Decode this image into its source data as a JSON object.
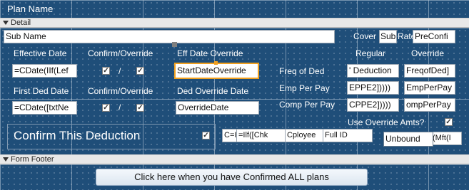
{
  "header": {
    "plan_name_label": "Plan Name"
  },
  "detail_section": {
    "label": "Detail"
  },
  "sub_name": {
    "value": "Sub Name"
  },
  "coverage": {
    "cover": "Cover",
    "sub": "Sub",
    "rate": "Rate",
    "preconfirm": "PreConfi"
  },
  "labels": {
    "effective_date": "Effective Date",
    "confirm_override_1": "Confirm/Override",
    "eff_date_override": "Eff Date Override",
    "regular": "Regular",
    "override": "Override",
    "first_ded_date": "First Ded Date",
    "confirm_override_2": "Confirm/Override",
    "ded_override_date": "Ded Override Date",
    "freq_of_ded": "Freq of Ded",
    "emp_per_pay": "Emp Per Pay",
    "comp_per_pay": "Comp Per Pay",
    "use_override_amts": "Use Override Amts?",
    "confirm_this_deduction": "Confirm This Deduction"
  },
  "fields": {
    "effective_date_expr": "=CDate(IIf(Lef",
    "start_date_override": "StartDateOverride",
    "first_ded_expr": "=CDate([txtNe",
    "override_date": "OverrideDate",
    "freq_regular": "' Deduction",
    "freq_override": "FreqofDed]",
    "emp_regular": "EPPE2]))))",
    "emp_override": "EmpPerPay",
    "comp_regular": "CPPE2]))))",
    "comp_override": "ompPerPay",
    "calc_a": "C=I",
    "calc_b": "=Ilf([Chk",
    "calc_c": "Cployee",
    "full_id": "Full ID",
    "unbound": "Unbound",
    "calc_d": "(Mft(I"
  },
  "separators": {
    "slash": "/"
  },
  "checkbox_mark": "✓",
  "footer_section": {
    "label": "Form Footer"
  },
  "footer_button": {
    "label": "Click here when you have Confirmed ALL plans"
  }
}
